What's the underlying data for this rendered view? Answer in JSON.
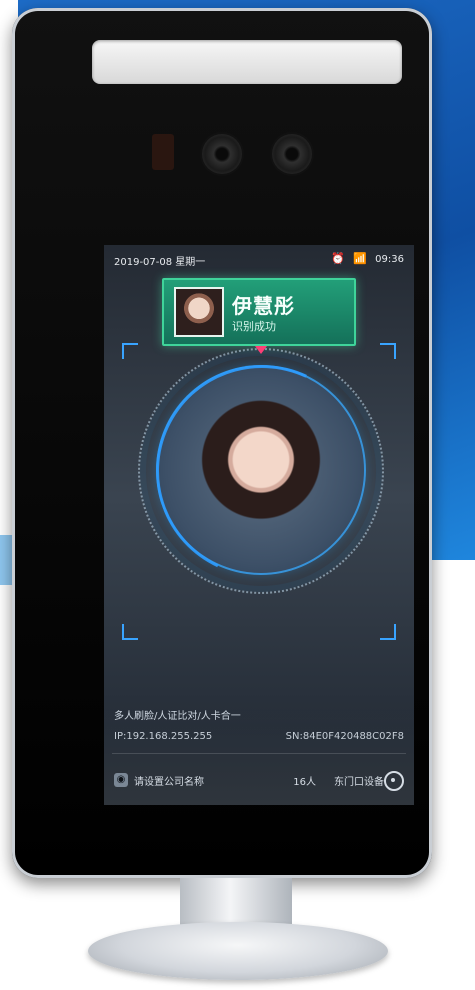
{
  "status_bar": {
    "datetime": "2019-07-08 星期一",
    "time": "09:36"
  },
  "recognition": {
    "name": "伊慧彤",
    "result": "识别成功"
  },
  "info": {
    "mode": "多人刷脸/人证比对/人卡合一",
    "ip": "IP:192.168.255.255",
    "sn": "SN:84E0F420488C02F8"
  },
  "footer": {
    "company": "请设置公司名称",
    "count": "16人",
    "device": "东门口设备"
  },
  "icons": {
    "alarm": "alarm-icon",
    "wifi": "wifi-icon",
    "company": "company-icon",
    "settings": "gear-icon"
  },
  "colors": {
    "accent": "#2e9dff",
    "success": "#3fd49a",
    "marker": "#ff3e76"
  }
}
